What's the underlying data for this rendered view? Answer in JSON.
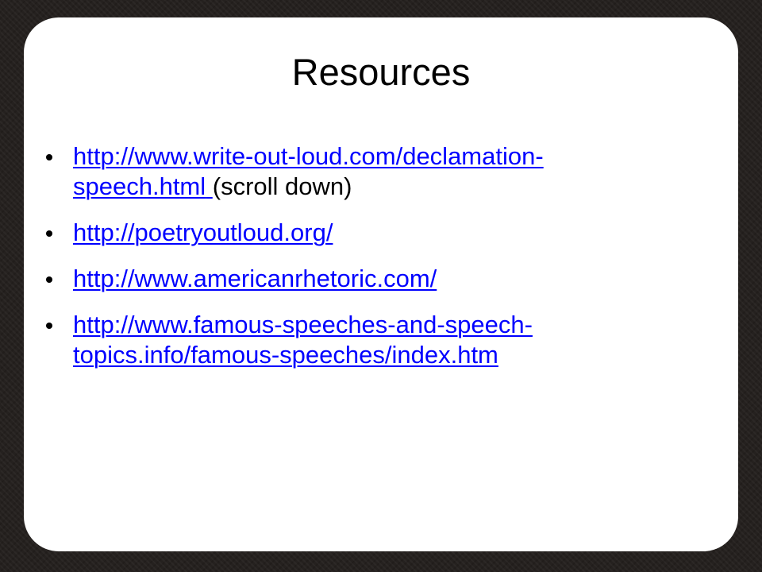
{
  "slide": {
    "title": "Resources",
    "items": [
      {
        "link_line1": "http://www.write-out-loud.com/declamation-",
        "link_line2": "speech.html",
        "note": " (scroll down)"
      },
      {
        "link": "http://poetryoutloud.org/"
      },
      {
        "link": "http://www.americanrhetoric.com/"
      },
      {
        "link_line1": "http://www.famous-speeches-and-speech-",
        "link_line2": "topics.info/famous-speeches/index.htm"
      }
    ]
  },
  "colors": {
    "link": "#0000ff",
    "text": "#000000",
    "card": "#ffffff",
    "frame": "#25211f"
  }
}
